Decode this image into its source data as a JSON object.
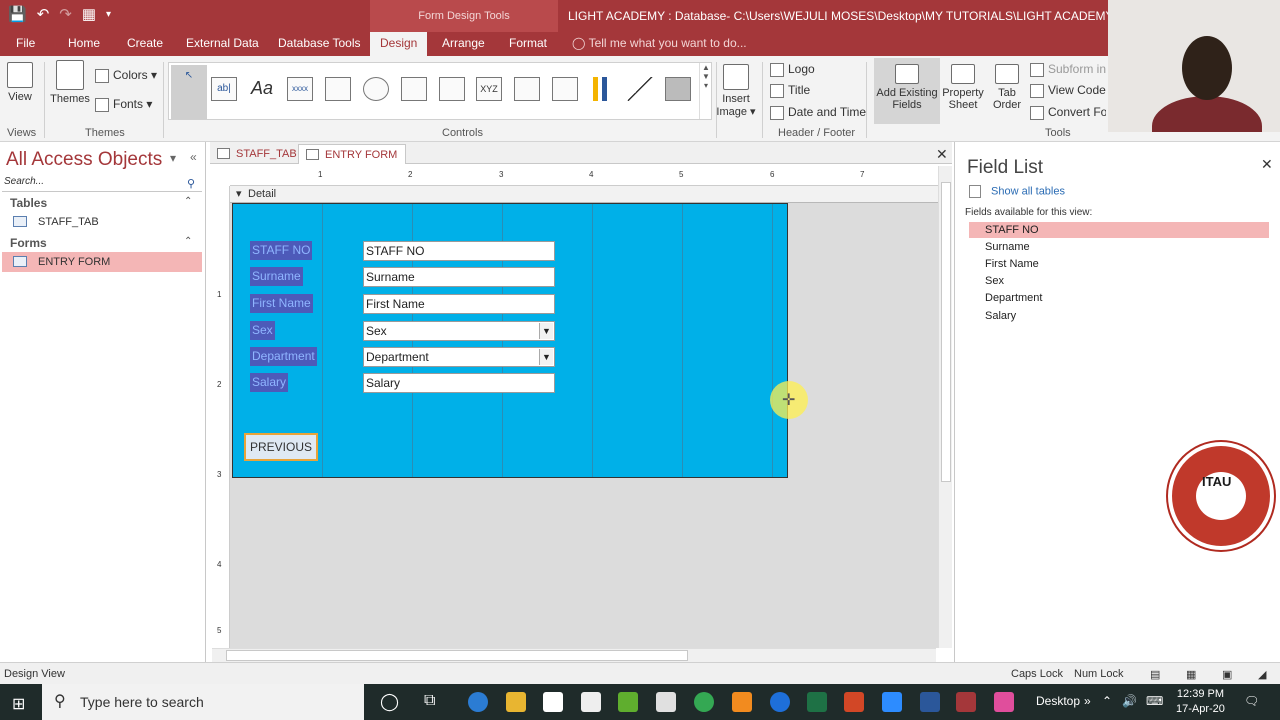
{
  "titlebar": {
    "context_tab": "Form Design Tools",
    "window_title": "LIGHT ACADEMY : Database- C:\\Users\\WEJULI MOSES\\Desktop\\MY TUTORIALS\\LIGHT ACADEMY.accdb (..."
  },
  "ribbon_tabs": [
    "File",
    "Home",
    "Create",
    "External Data",
    "Database Tools",
    "Design",
    "Arrange",
    "Format"
  ],
  "active_tab": "Design",
  "tell_me": "Tell me what you want to do...",
  "ribbon": {
    "view": "View",
    "themes": "Themes",
    "colors": "Colors",
    "fonts": "Fonts",
    "groups": {
      "views": "Views",
      "themes": "Themes",
      "controls": "Controls",
      "header_footer": "Header / Footer",
      "tools": "Tools"
    },
    "controls": {
      "textbox": "ab|",
      "label": "Aa",
      "button": "xxxx",
      "chart_xyz": "XYZ"
    },
    "insert_image": [
      "Insert",
      "Image"
    ],
    "logo": "Logo",
    "title": "Title",
    "date_time": "Date and Time",
    "add_existing_fields": [
      "Add Existing",
      "Fields"
    ],
    "property_sheet": [
      "Property",
      "Sheet"
    ],
    "tab_order": [
      "Tab",
      "Order"
    ],
    "subform": "Subform in N",
    "view_code": "View Code",
    "convert_form": "Convert Form"
  },
  "nav": {
    "title": "All Access Objects",
    "search_placeholder": "Search...",
    "sections": [
      {
        "name": "Tables",
        "items": [
          "STAFF_TAB"
        ]
      },
      {
        "name": "Forms",
        "items": [
          "ENTRY FORM"
        ]
      }
    ],
    "active_item": "ENTRY FORM"
  },
  "doc_tabs": [
    "STAFF_TAB",
    "ENTRY FORM"
  ],
  "active_doc_tab": "ENTRY FORM",
  "ruler_numbers": [
    "1",
    "2",
    "3",
    "4",
    "5",
    "6",
    "7"
  ],
  "vruler_numbers": [
    "1",
    "2",
    "3",
    "4",
    "5"
  ],
  "section_name": "Detail",
  "form": {
    "fields": [
      {
        "label": "STAFF NO",
        "control": "STAFF NO",
        "dropdown": false
      },
      {
        "label": "Surname",
        "control": "Surname",
        "dropdown": false
      },
      {
        "label": "First Name",
        "control": "First Name",
        "dropdown": false
      },
      {
        "label": "Sex",
        "control": "Sex",
        "dropdown": true
      },
      {
        "label": "Department",
        "control": "Department",
        "dropdown": true
      },
      {
        "label": "Salary",
        "control": "Salary",
        "dropdown": false
      }
    ],
    "previous_button": "PREVIOUS"
  },
  "field_list": {
    "title": "Field List",
    "show_all": "Show all tables",
    "available": "Fields available for this view:",
    "fields": [
      "STAFF NO",
      "Surname",
      "First Name",
      "Sex",
      "Department",
      "Salary"
    ],
    "active_field": "STAFF NO"
  },
  "logo_text": "ITAU",
  "statusbar": {
    "mode": "Design View",
    "caps": "Caps Lock",
    "num": "Num Lock"
  },
  "taskbar": {
    "search_placeholder": "Type here to search",
    "desktop": "Desktop",
    "time": "12:39 PM",
    "date": "17-Apr-20"
  },
  "colors": {
    "brand": "#a4373a",
    "form_background": "#00b0e8",
    "label_fill": "#4d5ab9",
    "selection": "#f4b6b6"
  }
}
